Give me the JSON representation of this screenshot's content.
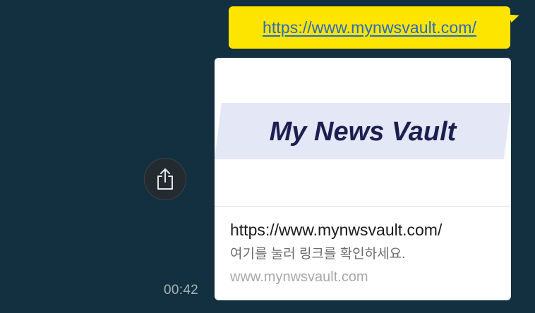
{
  "message": {
    "link_text": "https://www.mynwsvault.com/"
  },
  "preview": {
    "logo_text": "My News Vault",
    "title": "https://www.mynwsvault.com/",
    "description": "여기를 눌러 링크를 확인하세요.",
    "domain": "www.mynwsvault.com"
  },
  "share": {
    "icon": "share-icon"
  },
  "timestamp": "00:42",
  "colors": {
    "background": "#12303f",
    "bubble": "#fee500",
    "link": "#2b69c7",
    "logo_band": "#e4e7f6",
    "logo_text": "#1c1f4f"
  }
}
